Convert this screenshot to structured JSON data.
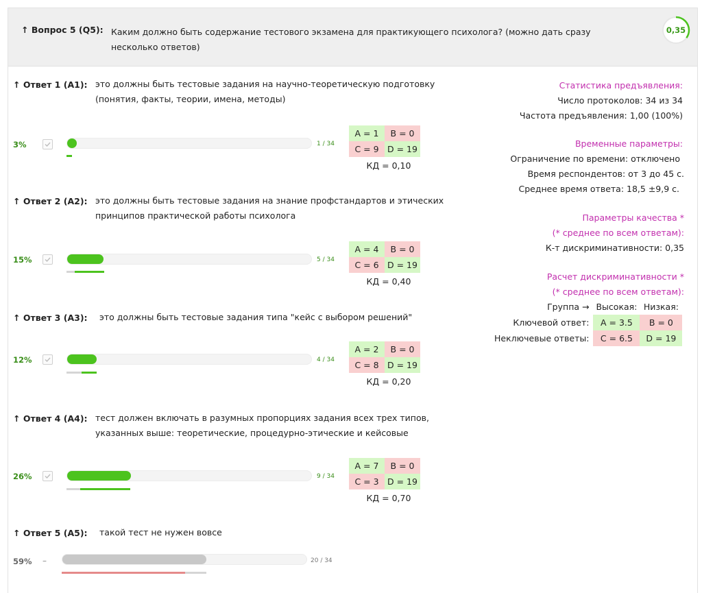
{
  "question": {
    "label": "↑ Вопрос 5 (Q5):",
    "text": "Каким должно быть содержание тестового экзамена для практикующего психолога? (можно дать сразу несколько ответов)",
    "score": "0,35",
    "score_fraction": 0.35
  },
  "answers": [
    {
      "label": "↑ Ответ 1 (А1):",
      "text": "это должны быть тестовые задания на научно-теоретическую подготовку (понятия, факты, теории, имена, методы)",
      "percent": "3%",
      "count": "1 / 34",
      "fraction": 0.03,
      "checked": true,
      "matrix": {
        "a": "A = 1",
        "b": "B = 0",
        "c": "C = 9",
        "d": "D = 19"
      },
      "kd": "КД = 0,10"
    },
    {
      "label": "↑ Ответ 2 (А2):",
      "text": "это должны быть тестовые задания на знание профстандартов и этических принципов практической работы психолога",
      "percent": "15%",
      "count": "5 / 34",
      "fraction": 0.15,
      "checked": true,
      "matrix": {
        "a": "A = 4",
        "b": "B = 0",
        "c": "C = 6",
        "d": "D = 19"
      },
      "kd": "КД = 0,40"
    },
    {
      "label": "↑ Ответ 3 (А3):",
      "text": "это должны быть тестовые задания типа \"кейс с выбором решений\"",
      "percent": "12%",
      "count": "4 / 34",
      "fraction": 0.12,
      "checked": true,
      "matrix": {
        "a": "A = 2",
        "b": "B = 0",
        "c": "C = 8",
        "d": "D = 19"
      },
      "kd": "КД = 0,20"
    },
    {
      "label": "↑ Ответ 4 (А4):",
      "text": "тест должен включать в разумных пропорциях задания всех трех типов, указанных выше: теоретические, процедурно-этические и кейсовые",
      "percent": "26%",
      "count": "9 / 34",
      "fraction": 0.26,
      "checked": true,
      "matrix": {
        "a": "A = 7",
        "b": "B = 0",
        "c": "C = 3",
        "d": "D = 19"
      },
      "kd": "КД = 0,70"
    },
    {
      "label": "↑ Ответ 5 (А5):",
      "text": "такой тест не нужен вовсе",
      "percent": "59%",
      "count": "20 / 34",
      "fraction": 0.59,
      "checked": false,
      "dash": "–"
    }
  ],
  "stats": {
    "title": "Статистика предъявления:",
    "protocols": "Число протоколов:  34 из 34",
    "frequency": "Частота предъявления:  1,00 (100%)",
    "time_title": "Временные параметры:",
    "time_limit": "Ограничение по времени:  отключено",
    "resp_time": "Время респондентов:  от 3 до 45 с.",
    "avg_time": "Среднее время ответа:  18,5 ±9,9 с.",
    "quality_title": "Параметры качества *",
    "quality_note": "(* среднее по всем ответам):",
    "discr": "К-т дискриминативности:  0,35",
    "calc_title": "Расчет дискриминативности *",
    "calc_note": "(* среднее по всем ответам):",
    "group": "Группа →",
    "high": "Высокая:",
    "low": "Низкая:",
    "key_answer": "Ключевой ответ:",
    "nonkey": "Неключевые ответы:",
    "a": "A = 3.5",
    "b": "B = 0",
    "c": "C = 6.5",
    "d": "D = 19"
  },
  "colors": {
    "accent_green": "#4cc31e",
    "heading_magenta": "#c22fae",
    "cell_green": "#d6f7c6",
    "cell_red": "#f9d0d0"
  }
}
